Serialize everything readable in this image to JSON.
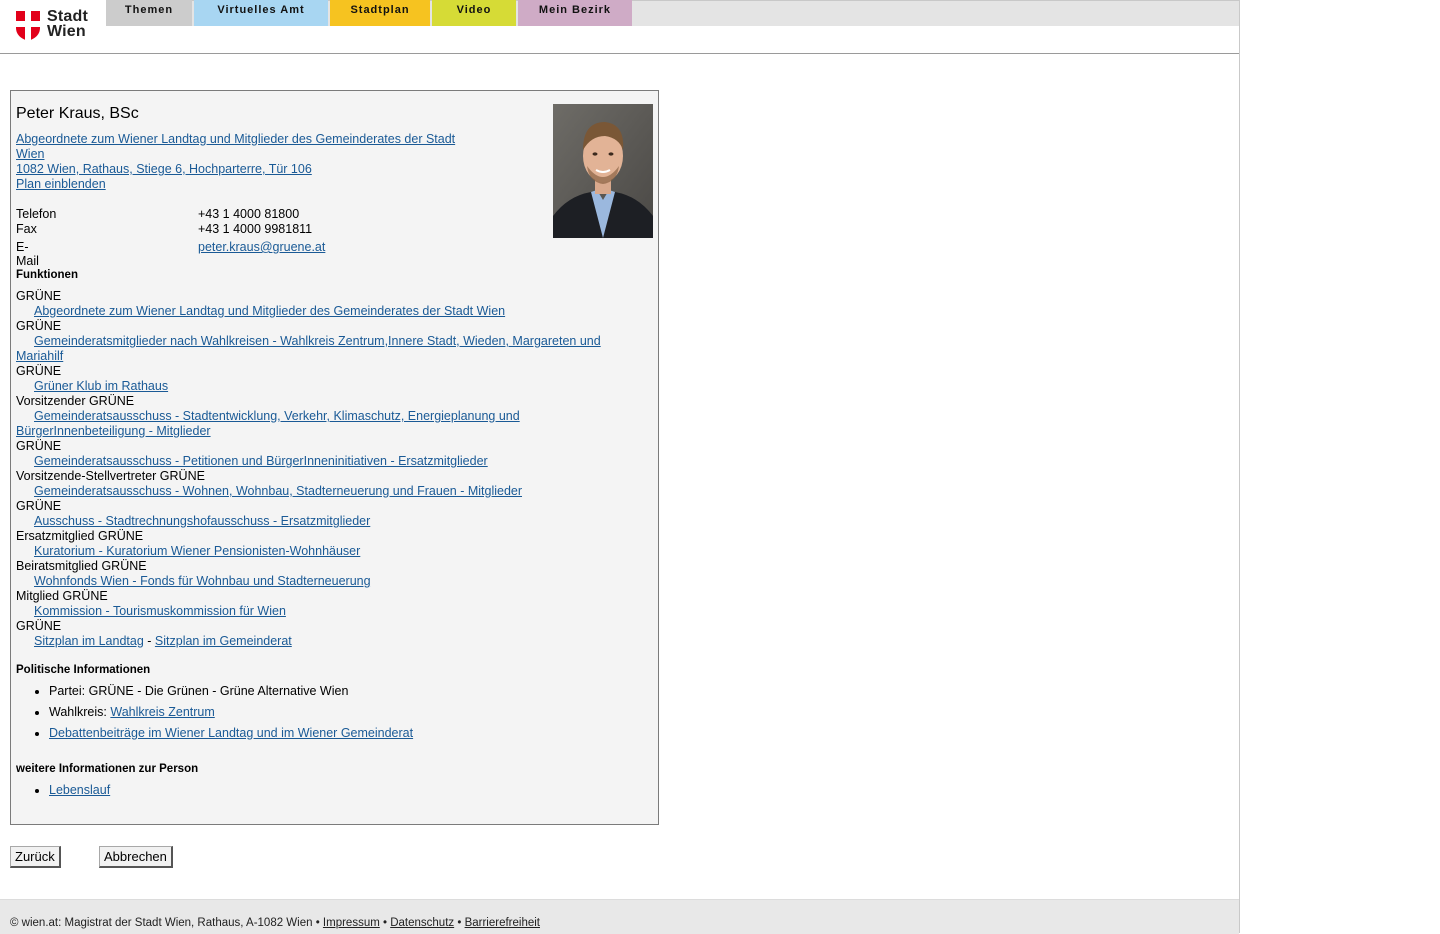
{
  "header": {
    "logo_line1": "Stadt",
    "logo_line2": "Wien",
    "tabs": [
      {
        "label": "Themen",
        "color": "#cccccc"
      },
      {
        "label": "Virtuelles Amt",
        "color": "#a8d6f2"
      },
      {
        "label": "Stadtplan",
        "color": "#f6c320"
      },
      {
        "label": "Video",
        "color": "#d6db36"
      },
      {
        "label": "Mein Bezirk",
        "color": "#cfabc6"
      }
    ]
  },
  "person": {
    "name": "Peter Kraus, BSc",
    "role_link": "Abgeordnete zum Wiener Landtag und Mitglieder des Gemeinderates der Stadt Wien",
    "address_link": "1082 Wien, Rathaus, Stiege 6, Hochparterre, Tür 106",
    "plan_link": "Plan einblenden"
  },
  "contact": {
    "phone_label": "Telefon",
    "phone": "+43 1 4000 81800",
    "fax_label": "Fax",
    "fax": "+43 1 4000 9981811",
    "email_label": "E-Mail",
    "email": "peter.kraus@gruene.at"
  },
  "functions": {
    "heading": "Funktionen",
    "items": [
      {
        "role": "GRÜNE",
        "link": "Abgeordnete zum Wiener Landtag und Mitglieder des Gemeinderates der Stadt Wien"
      },
      {
        "role": "GRÜNE",
        "link": "Gemeinderatsmitglieder nach Wahlkreisen - Wahlkreis Zentrum,Innere Stadt, Wieden, Margareten und Mariahilf"
      },
      {
        "role": "GRÜNE",
        "link": "Grüner Klub im Rathaus"
      },
      {
        "role": "Vorsitzender GRÜNE",
        "link": "Gemeinderatsausschuss - Stadtentwicklung, Verkehr, Klimaschutz, Energieplanung und BürgerInnenbeteiligung - Mitglieder"
      },
      {
        "role": "GRÜNE",
        "link": "Gemeinderatsausschuss - Petitionen und BürgerInneninitiativen - Ersatzmitglieder"
      },
      {
        "role": "Vorsitzende-Stellvertreter GRÜNE",
        "link": "Gemeinderatsausschuss - Wohnen, Wohnbau, Stadterneuerung und Frauen - Mitglieder"
      },
      {
        "role": "GRÜNE",
        "link": "Ausschuss - Stadtrechnungshofausschuss - Ersatzmitglieder"
      },
      {
        "role": "Ersatzmitglied GRÜNE",
        "link": "Kuratorium - Kuratorium Wiener Pensionisten-Wohnhäuser"
      },
      {
        "role": "Beiratsmitglied GRÜNE",
        "link": "Wohnfonds Wien - Fonds für Wohnbau und Stadterneuerung"
      },
      {
        "role": "Mitglied GRÜNE",
        "link": "Kommission - Tourismuskommission für Wien"
      }
    ],
    "last_role": "GRÜNE",
    "seat_landtag": "Sitzplan im Landtag",
    "seat_separator": " - ",
    "seat_gemeinderat": "Sitzplan im Gemeinderat"
  },
  "political": {
    "heading": "Politische Informationen",
    "party": "Partei: GRÜNE - Die Grünen - Grüne Alternative Wien",
    "district_label": "Wahlkreis: ",
    "district_link": "Wahlkreis Zentrum",
    "debates_link": "Debattenbeiträge im Wiener Landtag und im Wiener Gemeinderat"
  },
  "more": {
    "heading": "weitere Informationen zur Person",
    "cv_link": "Lebenslauf"
  },
  "buttons": {
    "back": "Zurück",
    "cancel": "Abbrechen"
  },
  "footer": {
    "text": "© wien.at: Magistrat der Stadt Wien, Rathaus, A-1082 Wien • ",
    "impressum": "Impressum",
    "sep": " • ",
    "datenschutz": "Datenschutz",
    "barrierefreiheit": "Barrierefreiheit"
  }
}
